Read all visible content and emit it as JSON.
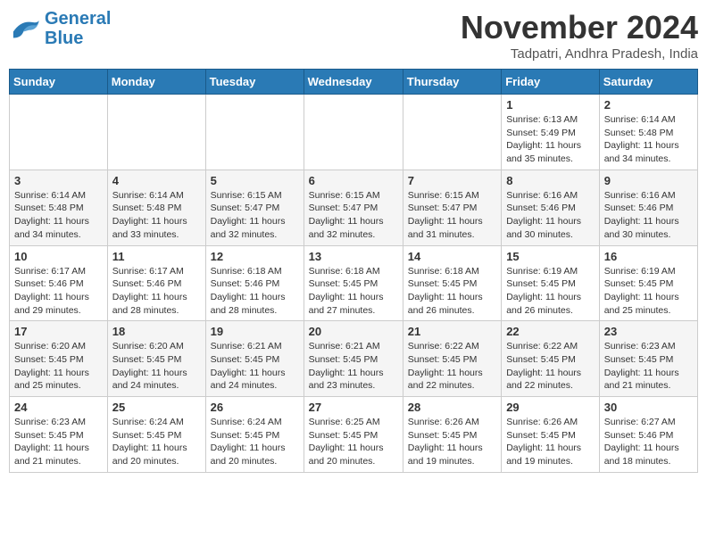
{
  "logo": {
    "line1": "General",
    "line2": "Blue"
  },
  "title": "November 2024",
  "subtitle": "Tadpatri, Andhra Pradesh, India",
  "days_header": [
    "Sunday",
    "Monday",
    "Tuesday",
    "Wednesday",
    "Thursday",
    "Friday",
    "Saturday"
  ],
  "weeks": [
    [
      {
        "day": "",
        "info": ""
      },
      {
        "day": "",
        "info": ""
      },
      {
        "day": "",
        "info": ""
      },
      {
        "day": "",
        "info": ""
      },
      {
        "day": "",
        "info": ""
      },
      {
        "day": "1",
        "info": "Sunrise: 6:13 AM\nSunset: 5:49 PM\nDaylight: 11 hours and 35 minutes."
      },
      {
        "day": "2",
        "info": "Sunrise: 6:14 AM\nSunset: 5:48 PM\nDaylight: 11 hours and 34 minutes."
      }
    ],
    [
      {
        "day": "3",
        "info": "Sunrise: 6:14 AM\nSunset: 5:48 PM\nDaylight: 11 hours and 34 minutes."
      },
      {
        "day": "4",
        "info": "Sunrise: 6:14 AM\nSunset: 5:48 PM\nDaylight: 11 hours and 33 minutes."
      },
      {
        "day": "5",
        "info": "Sunrise: 6:15 AM\nSunset: 5:47 PM\nDaylight: 11 hours and 32 minutes."
      },
      {
        "day": "6",
        "info": "Sunrise: 6:15 AM\nSunset: 5:47 PM\nDaylight: 11 hours and 32 minutes."
      },
      {
        "day": "7",
        "info": "Sunrise: 6:15 AM\nSunset: 5:47 PM\nDaylight: 11 hours and 31 minutes."
      },
      {
        "day": "8",
        "info": "Sunrise: 6:16 AM\nSunset: 5:46 PM\nDaylight: 11 hours and 30 minutes."
      },
      {
        "day": "9",
        "info": "Sunrise: 6:16 AM\nSunset: 5:46 PM\nDaylight: 11 hours and 30 minutes."
      }
    ],
    [
      {
        "day": "10",
        "info": "Sunrise: 6:17 AM\nSunset: 5:46 PM\nDaylight: 11 hours and 29 minutes."
      },
      {
        "day": "11",
        "info": "Sunrise: 6:17 AM\nSunset: 5:46 PM\nDaylight: 11 hours and 28 minutes."
      },
      {
        "day": "12",
        "info": "Sunrise: 6:18 AM\nSunset: 5:46 PM\nDaylight: 11 hours and 28 minutes."
      },
      {
        "day": "13",
        "info": "Sunrise: 6:18 AM\nSunset: 5:45 PM\nDaylight: 11 hours and 27 minutes."
      },
      {
        "day": "14",
        "info": "Sunrise: 6:18 AM\nSunset: 5:45 PM\nDaylight: 11 hours and 26 minutes."
      },
      {
        "day": "15",
        "info": "Sunrise: 6:19 AM\nSunset: 5:45 PM\nDaylight: 11 hours and 26 minutes."
      },
      {
        "day": "16",
        "info": "Sunrise: 6:19 AM\nSunset: 5:45 PM\nDaylight: 11 hours and 25 minutes."
      }
    ],
    [
      {
        "day": "17",
        "info": "Sunrise: 6:20 AM\nSunset: 5:45 PM\nDaylight: 11 hours and 25 minutes."
      },
      {
        "day": "18",
        "info": "Sunrise: 6:20 AM\nSunset: 5:45 PM\nDaylight: 11 hours and 24 minutes."
      },
      {
        "day": "19",
        "info": "Sunrise: 6:21 AM\nSunset: 5:45 PM\nDaylight: 11 hours and 24 minutes."
      },
      {
        "day": "20",
        "info": "Sunrise: 6:21 AM\nSunset: 5:45 PM\nDaylight: 11 hours and 23 minutes."
      },
      {
        "day": "21",
        "info": "Sunrise: 6:22 AM\nSunset: 5:45 PM\nDaylight: 11 hours and 22 minutes."
      },
      {
        "day": "22",
        "info": "Sunrise: 6:22 AM\nSunset: 5:45 PM\nDaylight: 11 hours and 22 minutes."
      },
      {
        "day": "23",
        "info": "Sunrise: 6:23 AM\nSunset: 5:45 PM\nDaylight: 11 hours and 21 minutes."
      }
    ],
    [
      {
        "day": "24",
        "info": "Sunrise: 6:23 AM\nSunset: 5:45 PM\nDaylight: 11 hours and 21 minutes."
      },
      {
        "day": "25",
        "info": "Sunrise: 6:24 AM\nSunset: 5:45 PM\nDaylight: 11 hours and 20 minutes."
      },
      {
        "day": "26",
        "info": "Sunrise: 6:24 AM\nSunset: 5:45 PM\nDaylight: 11 hours and 20 minutes."
      },
      {
        "day": "27",
        "info": "Sunrise: 6:25 AM\nSunset: 5:45 PM\nDaylight: 11 hours and 20 minutes."
      },
      {
        "day": "28",
        "info": "Sunrise: 6:26 AM\nSunset: 5:45 PM\nDaylight: 11 hours and 19 minutes."
      },
      {
        "day": "29",
        "info": "Sunrise: 6:26 AM\nSunset: 5:45 PM\nDaylight: 11 hours and 19 minutes."
      },
      {
        "day": "30",
        "info": "Sunrise: 6:27 AM\nSunset: 5:46 PM\nDaylight: 11 hours and 18 minutes."
      }
    ]
  ]
}
